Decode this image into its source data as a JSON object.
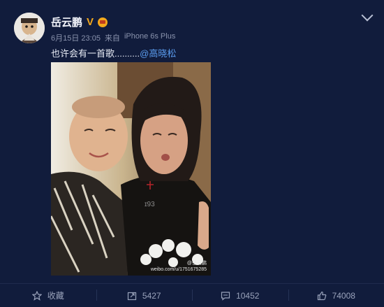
{
  "user": {
    "name": "岳云鹏",
    "badge_v": "V"
  },
  "meta": {
    "date": "6月15日 23:05",
    "via": "来自",
    "device": "iPhone 6s Plus"
  },
  "post": {
    "text": "也许会有一首歌..........",
    "mention": "@高晓松"
  },
  "photo": {
    "watermark_line1": "@岳云鹏",
    "watermark_line2": "weibo.com/u/1751675285"
  },
  "actions": [
    {
      "icon": "star-icon",
      "label": "收藏"
    },
    {
      "icon": "repost-icon",
      "label": "5427"
    },
    {
      "icon": "comment-icon",
      "label": "10452"
    },
    {
      "icon": "thumbs-up-icon",
      "label": "74008"
    }
  ],
  "colors": {
    "background": "#111c3c",
    "accent_link": "#5b9df0",
    "badge": "#f3a81c"
  }
}
